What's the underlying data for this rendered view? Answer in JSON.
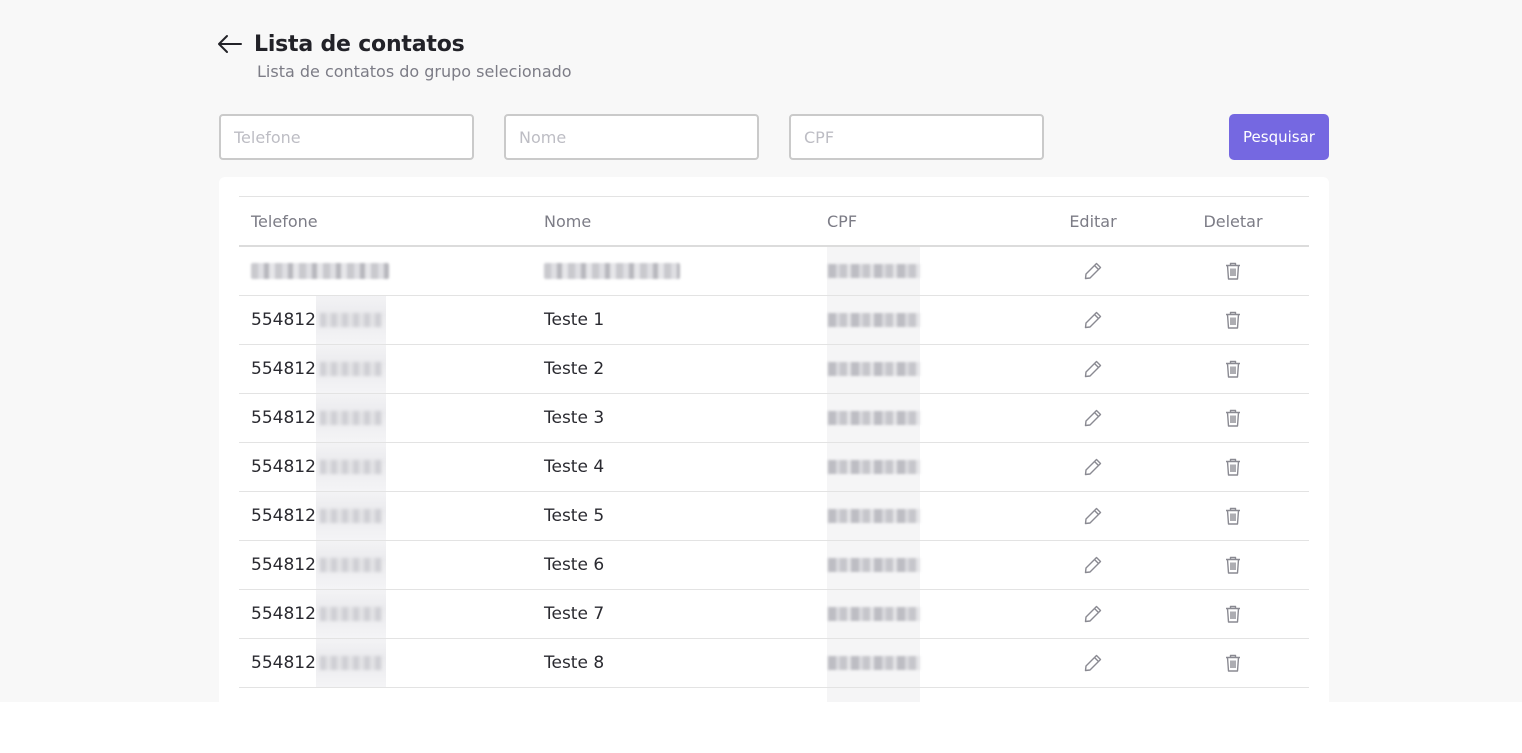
{
  "header": {
    "title": "Lista de contatos",
    "subtitle": "Lista de contatos do grupo selecionado",
    "back_icon": "arrow-left-icon"
  },
  "filters": {
    "phone_placeholder": "Telefone",
    "name_placeholder": "Nome",
    "cpf_placeholder": "CPF",
    "search_label": "Pesquisar"
  },
  "colors": {
    "accent": "#7568e1",
    "background": "#f8f8f8",
    "text": "#2a2a30",
    "muted": "#7c7c86"
  },
  "table": {
    "columns": {
      "phone": "Telefone",
      "name": "Nome",
      "cpf": "CPF",
      "edit": "Editar",
      "delete": "Deletar"
    },
    "edit_icon": "pencil-icon",
    "delete_icon": "trash-icon",
    "rows": [
      {
        "phone": "",
        "name": ""
      },
      {
        "phone": "554812",
        "name": "Teste 1"
      },
      {
        "phone": "554812",
        "name": "Teste 2"
      },
      {
        "phone": "554812",
        "name": "Teste 3"
      },
      {
        "phone": "554812",
        "name": "Teste 4"
      },
      {
        "phone": "554812",
        "name": "Teste 5"
      },
      {
        "phone": "554812",
        "name": "Teste 6"
      },
      {
        "phone": "554812",
        "name": "Teste 7"
      },
      {
        "phone": "554812",
        "name": "Teste 8"
      }
    ]
  }
}
